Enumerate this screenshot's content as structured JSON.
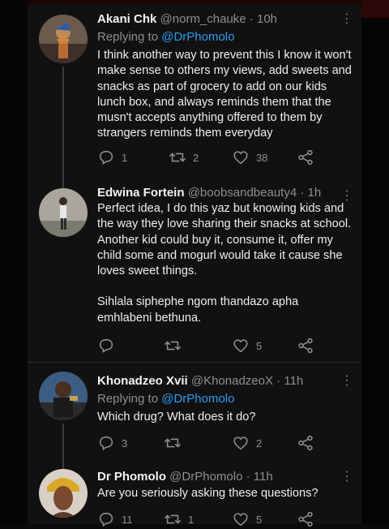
{
  "tweets": [
    {
      "name": "Akani Chk",
      "handle": "@norm_chauke",
      "time": "· 10h",
      "replying_prefix": "Replying to",
      "replying_to": "@DrPhomolo",
      "paragraphs": [
        "I think another way to prevent this I know it won't make sense to others my views, add sweets and snacks as part of grocery to add on our kids lunch box, and always reminds them that the musn't accepts anything  offered to them by strangers reminds them everyday"
      ],
      "replies": "1",
      "retweets": "2",
      "likes": "38"
    },
    {
      "name": "Edwina Fortein",
      "handle": "@boobsandbeauty4",
      "time": "· 1h",
      "paragraphs": [
        "Perfect idea, I do this yaz but knowing kids and the way they love sharing their snacks at school. Another kid could buy it, consume it, offer my child some and mogurl would take it cause she loves sweet things.",
        "Sihlala siphephe ngom thandazo apha emhlabeni bethuna."
      ],
      "replies": "",
      "retweets": "",
      "likes": "5"
    },
    {
      "name": "Khonadzeo Xvii",
      "handle": "@KhonadzeoX",
      "time": "· 11h",
      "replying_prefix": "Replying to",
      "replying_to": "@DrPhomolo",
      "paragraphs": [
        "Which drug? What does it do?"
      ],
      "replies": "3",
      "retweets": "",
      "likes": "2"
    },
    {
      "name": "Dr Phomolo",
      "handle": "@DrPhomolo",
      "time": "· 11h",
      "paragraphs": [
        "Are you seriously asking these questions?"
      ],
      "replies": "11",
      "retweets": "1",
      "likes": "5"
    }
  ],
  "icons": {
    "reply": "reply-icon",
    "retweet": "retweet-icon",
    "like": "heart-icon",
    "share": "share-icon",
    "more": "more-vertical-icon"
  },
  "colors": {
    "background": "#111111",
    "text": "#eceff1",
    "muted": "#8b8f93",
    "mention": "#2f9bf0"
  }
}
